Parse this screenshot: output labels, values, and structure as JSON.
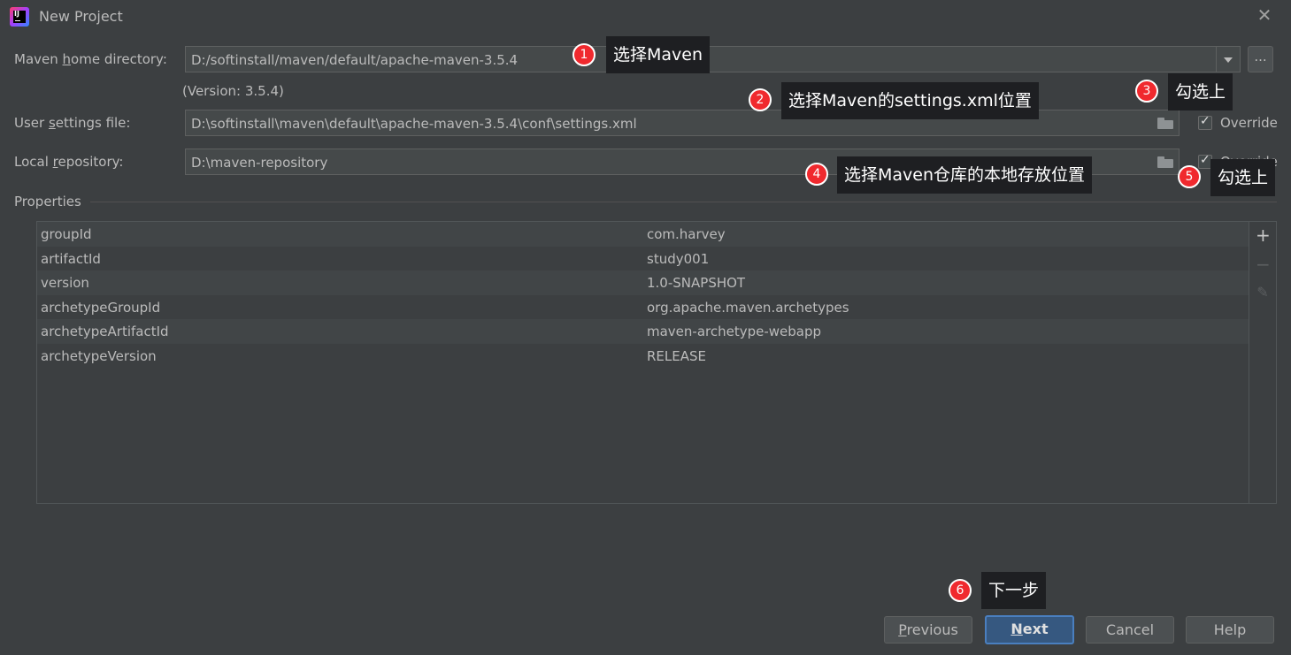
{
  "window": {
    "title": "New Project",
    "close_glyph": "✕"
  },
  "form": {
    "maven_home": {
      "label_pre": "Maven ",
      "label_u": "h",
      "label_post": "ome directory:",
      "value": "D:/softinstall/maven/default/apache-maven-3.5.4",
      "browse_label": "..."
    },
    "version_text": "(Version: 3.5.4)",
    "user_settings": {
      "label_pre": "User ",
      "label_u": "s",
      "label_post": "ettings file:",
      "value": "D:\\softinstall\\maven\\default\\apache-maven-3.5.4\\conf\\settings.xml",
      "override_label": "Override",
      "override_checked": true
    },
    "local_repo": {
      "label_pre": "Local ",
      "label_u": "r",
      "label_post": "epository:",
      "value": "D:\\maven-repository",
      "override_label": "Override",
      "override_checked": true
    }
  },
  "properties": {
    "title": "Properties",
    "rows": [
      {
        "key": "groupId",
        "value": "com.harvey"
      },
      {
        "key": "artifactId",
        "value": "study001"
      },
      {
        "key": "version",
        "value": "1.0-SNAPSHOT"
      },
      {
        "key": "archetypeGroupId",
        "value": "org.apache.maven.archetypes"
      },
      {
        "key": "archetypeArtifactId",
        "value": "maven-archetype-webapp"
      },
      {
        "key": "archetypeVersion",
        "value": "RELEASE"
      }
    ],
    "tools": {
      "add": "+",
      "remove": "−",
      "edit": "✎"
    }
  },
  "buttons": {
    "previous": {
      "u": "P",
      "rest": "revious"
    },
    "next": {
      "u": "N",
      "rest": "ext"
    },
    "cancel": "Cancel",
    "help": "Help"
  },
  "annotations": [
    {
      "num": "1",
      "text": "选择Maven"
    },
    {
      "num": "2",
      "text": "选择Maven的settings.xml位置"
    },
    {
      "num": "3",
      "text": "勾选上"
    },
    {
      "num": "4",
      "text": "选择Maven仓库的本地存放位置"
    },
    {
      "num": "5",
      "text": "勾选上"
    },
    {
      "num": "6",
      "text": "下一步"
    }
  ],
  "colors": {
    "background": "#3c3f41",
    "field": "#45494a",
    "primary_button": "#365880",
    "badge": "#f0292e",
    "tooltip": "#1e1f22"
  }
}
